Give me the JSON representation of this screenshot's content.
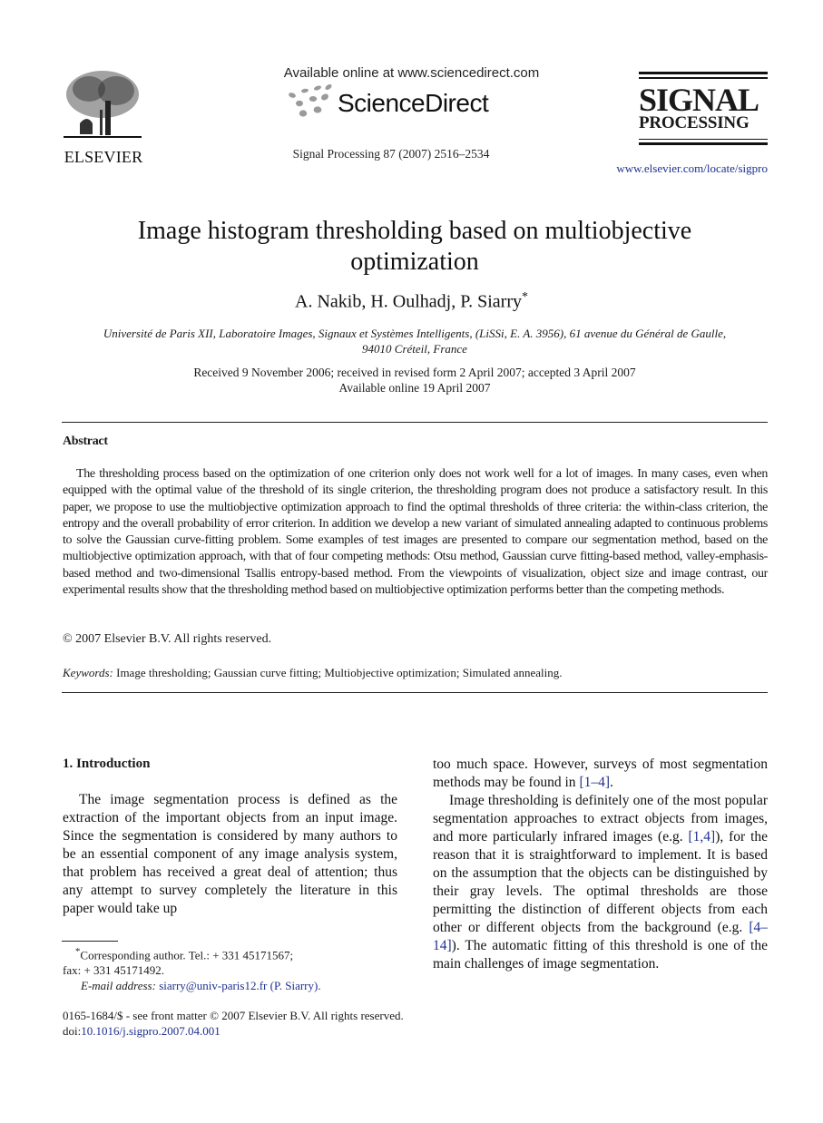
{
  "header": {
    "publisher_name": "ELSEVIER",
    "available_online": "Available online at www.sciencedirect.com",
    "sd_logo_text": "ScienceDirect",
    "journal_ref": "Signal Processing 87 (2007) 2516–2534",
    "journal_logo_line1": "SIGNAL",
    "journal_logo_line2": "PROCESSING",
    "journal_url": "www.elsevier.com/locate/sigpro",
    "icons": [
      "elsevier-tree-logo",
      "sciencedirect-dots-logo"
    ]
  },
  "article": {
    "title": "Image histogram thresholding based on multiobjective optimization",
    "authors": "A. Nakib, H. Oulhadj, P. Siarry",
    "author_mark": "*",
    "affiliation_line1": "Université de Paris XII, Laboratoire Images, Signaux et Systèmes Intelligents, (LiSSi, E. A. 3956), 61 avenue du Général de Gaulle,",
    "affiliation_line2": "94010 Créteil, France",
    "dates_line1": "Received 9 November 2006; received in revised form 2 April 2007; accepted 3 April 2007",
    "dates_line2": "Available online 19 April 2007"
  },
  "abstract": {
    "heading": "Abstract",
    "text": "The thresholding process based on the optimization of one criterion only does not work well for a lot of images. In many cases, even when equipped with the optimal value of the threshold of its single criterion, the thresholding program does not produce a satisfactory result. In this paper, we propose to use the multiobjective optimization approach to find the optimal thresholds of three criteria: the within-class criterion, the entropy and the overall probability of error criterion. In addition we develop a new variant of simulated annealing adapted to continuous problems to solve the Gaussian curve-fitting problem. Some examples of test images are presented to compare our segmentation method, based on the multiobjective optimization approach, with that of four competing methods: Otsu method, Gaussian curve fitting-based method, valley-emphasis-based method and two-dimensional Tsallis entropy-based method. From the viewpoints of visualization, object size and image contrast, our experimental results show that the thresholding method based on multiobjective optimization performs better than the competing methods.",
    "copyright": "© 2007 Elsevier B.V. All rights reserved.",
    "keywords_label": "Keywords:",
    "keywords": "Image thresholding; Gaussian curve fitting; Multiobjective optimization; Simulated annealing."
  },
  "body": {
    "section_heading": "1.  Introduction",
    "left_para": "The image segmentation process is defined as the extraction of the important objects from an input image. Since the segmentation is considered by many authors to be an essential component of any image analysis system, that problem has received a great deal of attention; thus any attempt to survey completely the literature in this paper would take up",
    "right_p1_pre": "too much space. However, surveys of most segmentation methods may be found in ",
    "right_p1_ref": "[1–4]",
    "right_p1_post": ".",
    "right_p2_a": "Image thresholding is definitely one of the most popular segmentation approaches to extract objects from images, and more particularly infrared images (e.g. ",
    "right_p2_ref1": "[1,4]",
    "right_p2_b": "), for the reason that it is straightforward to implement. It is based on the assumption that the objects can be distinguished by their gray levels. The optimal thresholds are those permitting the distinction of different objects from each other or different objects from the background (e.g. ",
    "right_p2_ref2": "[4–14]",
    "right_p2_c": "). The automatic fitting of this threshold is one of the main challenges of image segmentation."
  },
  "footnotes": {
    "mark": "*",
    "line1": "Corresponding author. Tel.: + 331 45171567;",
    "line2": "fax: + 331 45171492.",
    "email_label": "E-mail address:",
    "email": "siarry@univ-paris12.fr (P. Siarry)."
  },
  "front_matter": {
    "issn_line": "0165-1684/$ - see front matter © 2007 Elsevier B.V. All rights reserved.",
    "doi_label": "doi:",
    "doi": "10.1016/j.sigpro.2007.04.001"
  }
}
